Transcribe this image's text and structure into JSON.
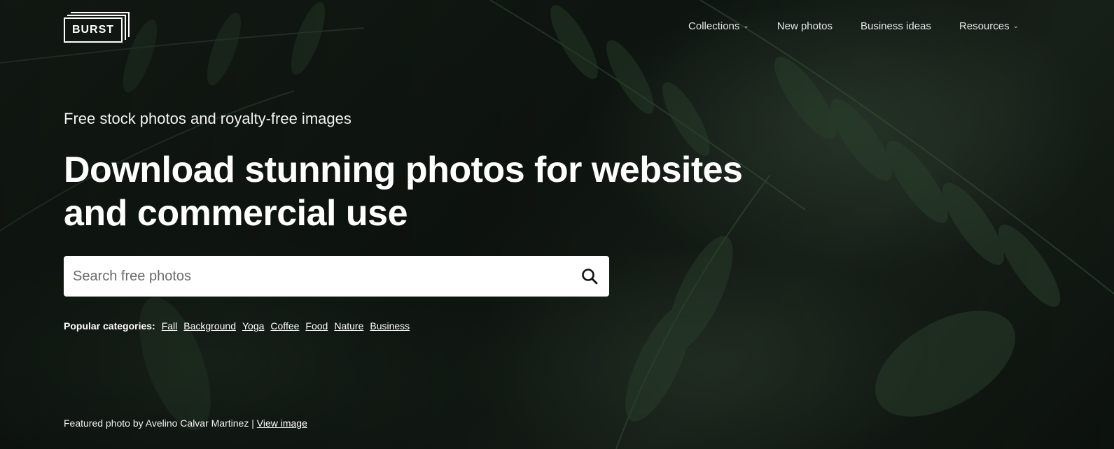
{
  "brand": {
    "logo_text": "BURST"
  },
  "nav": {
    "items": [
      {
        "label": "Collections",
        "has_dropdown": true
      },
      {
        "label": "New photos",
        "has_dropdown": false
      },
      {
        "label": "Business ideas",
        "has_dropdown": false
      },
      {
        "label": "Resources",
        "has_dropdown": true
      }
    ]
  },
  "hero": {
    "subtitle": "Free stock photos and royalty-free images",
    "headline": "Download stunning photos for websites and commercial use"
  },
  "search": {
    "placeholder": "Search free photos",
    "value": "",
    "icon": "search-icon"
  },
  "popular": {
    "label": "Popular categories:",
    "categories": [
      "Fall",
      "Background",
      "Yoga",
      "Coffee",
      "Food",
      "Nature",
      "Business"
    ]
  },
  "credit": {
    "text": "Featured photo by Avelino Calvar Martinez | ",
    "link": "View image"
  },
  "colors": {
    "text": "#ffffff",
    "background": "#121913",
    "search_bg": "#ffffff"
  }
}
